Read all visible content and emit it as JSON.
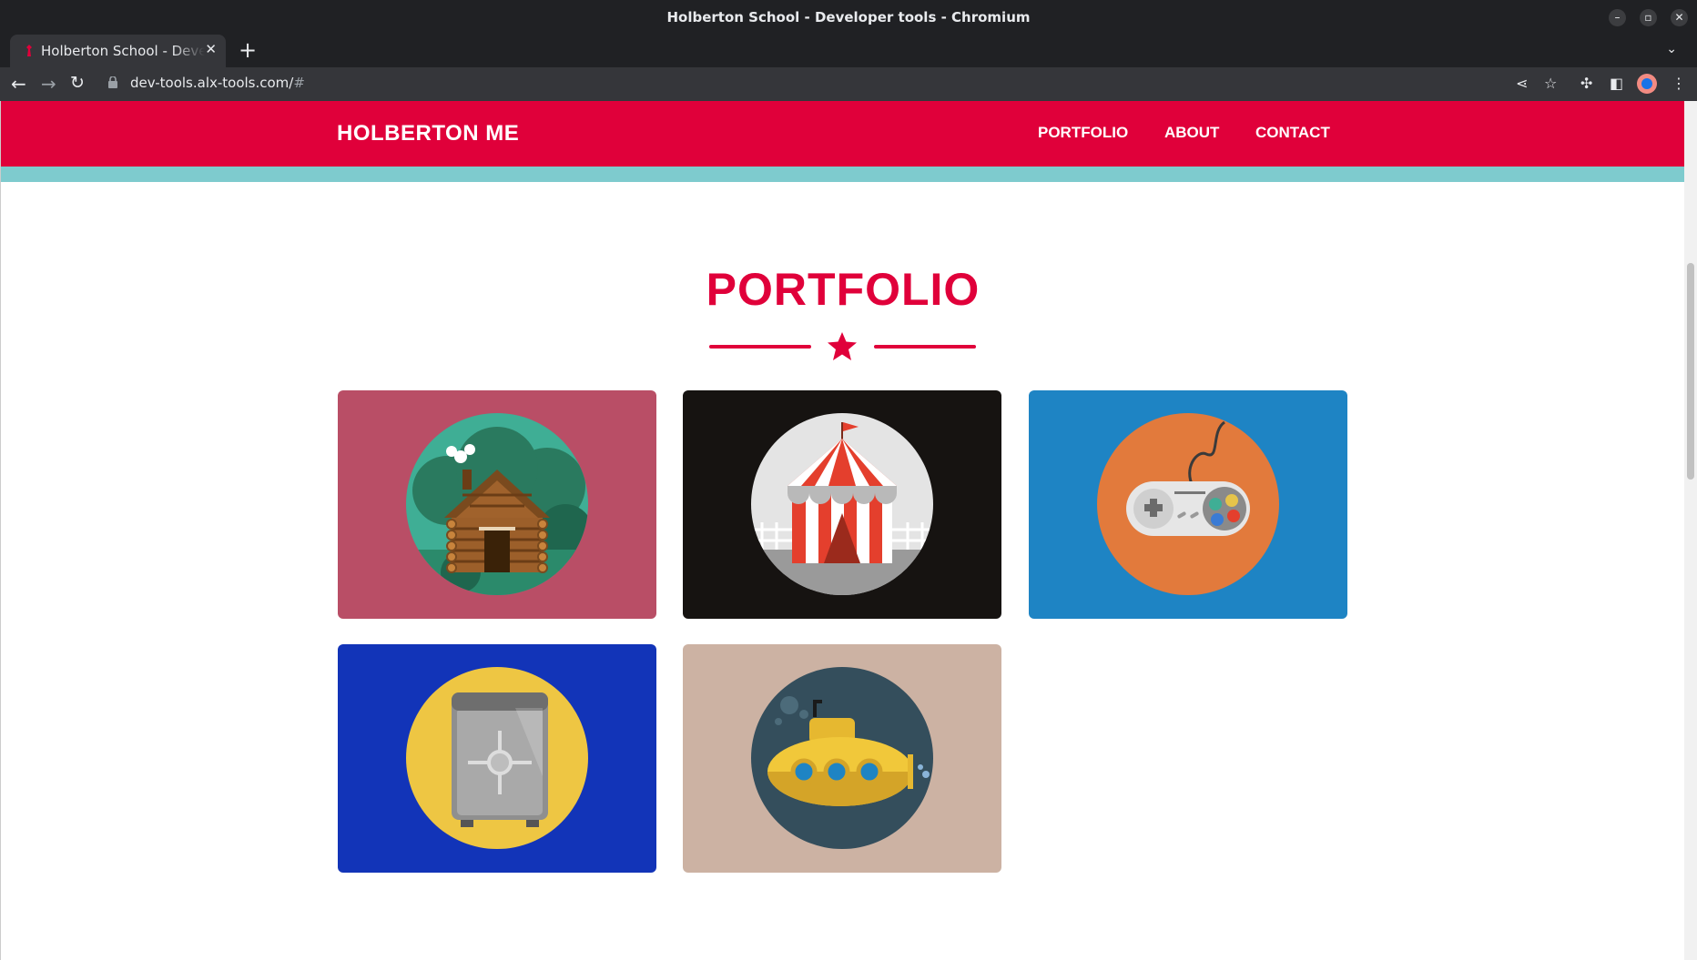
{
  "window": {
    "title": "Holberton School - Developer tools - Chromium"
  },
  "tab": {
    "title": "Holberton School - Developer tools"
  },
  "address_bar": {
    "url_host": "dev-tools.alx-tools.com/",
    "url_rest": "#"
  },
  "site": {
    "brand": "HOLBERTON ME",
    "nav": [
      "PORTFOLIO",
      "ABOUT",
      "CONTACT"
    ],
    "section_title": "PORTFOLIO"
  },
  "colors": {
    "header": "#e0003a",
    "stripe": "#7ecbce",
    "card_cabin": "#b94e66",
    "card_circus": "#161311",
    "card_gamepad": "#1e84c4",
    "card_safe": "#1234b8",
    "card_submarine": "#ccb2a3"
  },
  "portfolio_items": [
    {
      "name": "cabin",
      "icon": "log-cabin-icon"
    },
    {
      "name": "circus",
      "icon": "circus-tent-icon"
    },
    {
      "name": "gamepad",
      "icon": "game-controller-icon"
    },
    {
      "name": "safe",
      "icon": "safe-icon"
    },
    {
      "name": "submarine",
      "icon": "submarine-icon"
    }
  ]
}
